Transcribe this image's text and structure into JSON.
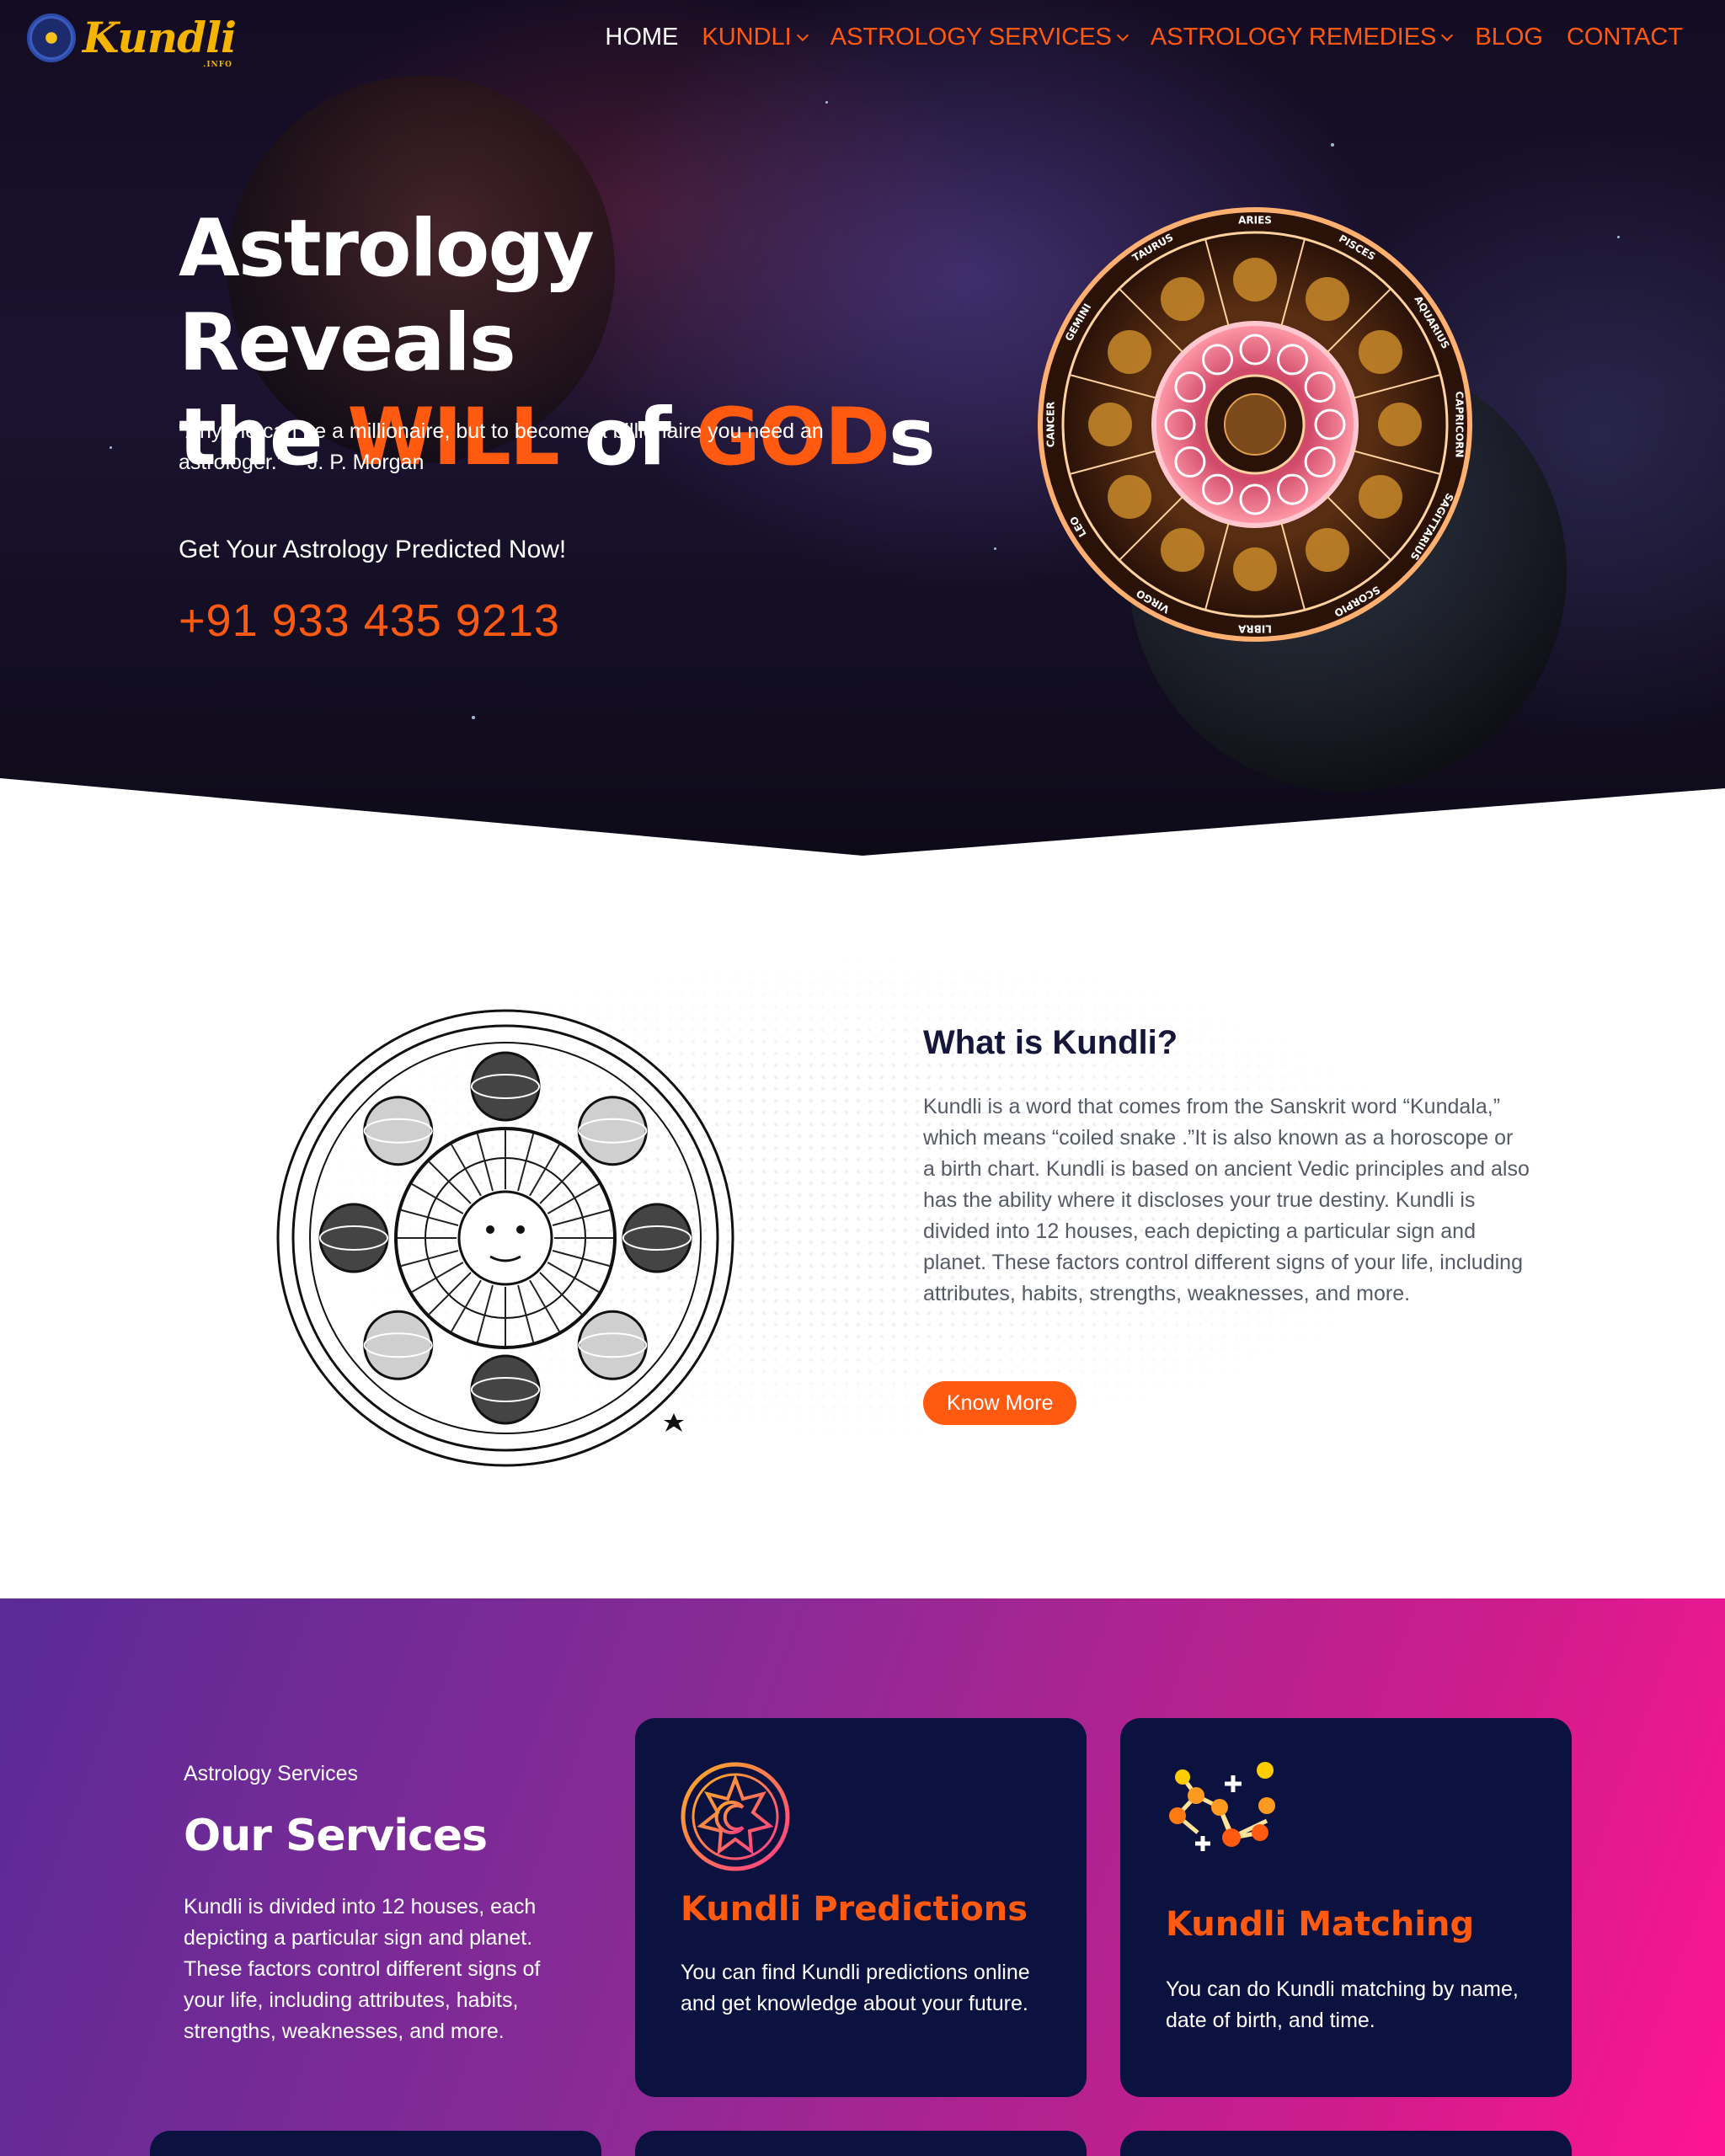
{
  "brand": {
    "name": "Kundli",
    "sub": ".INFO"
  },
  "nav": {
    "items": [
      {
        "label": "HOME",
        "active": true,
        "dropdown": false
      },
      {
        "label": "KUNDLI",
        "active": false,
        "dropdown": true
      },
      {
        "label": "ASTROLOGY SERVICES",
        "active": false,
        "dropdown": true
      },
      {
        "label": "ASTROLOGY REMEDIES",
        "active": false,
        "dropdown": true
      },
      {
        "label": "BLOG",
        "active": false,
        "dropdown": false
      },
      {
        "label": "CONTACT",
        "active": false,
        "dropdown": false
      }
    ]
  },
  "hero": {
    "title_line1": "Astrology Reveals",
    "title_the": "the",
    "title_will": "WILL",
    "title_of": "of",
    "title_god": "GOD",
    "title_s": "s",
    "quote": "“Anyone can be a millionaire, but to become a billionaire you need an astrologer.” – J. P. Morgan",
    "cta_text": "Get Your Astrology Predicted Now!",
    "phone": "+91 933 435 9213",
    "zodiac_signs": [
      "ARIES",
      "PISCES",
      "AQUARIUS",
      "CAPRICORN",
      "SAGITTARIUS",
      "SCORPIO",
      "LIBRA",
      "VIRGO",
      "LEO",
      "CANCER",
      "GEMINI",
      "TAURUS"
    ]
  },
  "about": {
    "title": "What is Kundli?",
    "text": "Kundli is a word that comes from the Sanskrit word “Kundala,” which means “coiled snake .”It is also known as a horoscope or a birth chart. Kundli is based on ancient Vedic principles and also has the ability where it discloses your true destiny. Kundli is divided into 12 houses, each depicting a particular sign and planet. These factors control different signs of your life, including attributes, habits, strengths, weaknesses, and more.",
    "button": "Know More"
  },
  "services": {
    "eyebrow": "Astrology Services",
    "title": "Our Services",
    "text": "Kundli is divided into 12 houses, each depicting a particular sign and planet. These factors control different signs of your life, including attributes, habits, strengths, weaknesses, and more.",
    "cards": [
      {
        "icon": "sun-moon-icon",
        "title": "Kundli Predictions",
        "text": "You can find Kundli predictions online and get knowledge about your future."
      },
      {
        "icon": "constellation-icon",
        "title": "Kundli Matching",
        "text": "You can do Kundli matching by name, date of birth, and time."
      }
    ]
  },
  "colors": {
    "accent": "#ff5a10",
    "card_bg": "#0c1240",
    "heading_dark": "#15163a"
  }
}
